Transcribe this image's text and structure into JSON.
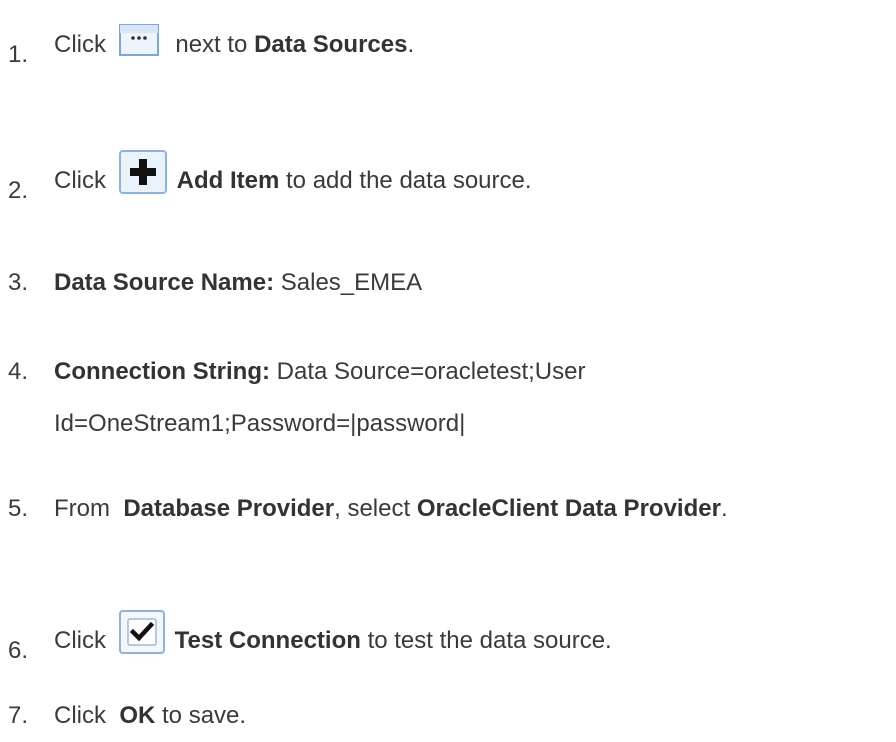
{
  "steps": [
    {
      "number": "1.",
      "text_before": "Click",
      "icon": "ellipsis-button-icon",
      "text_after": "next to",
      "bold": "Data Sources",
      "tail": "."
    },
    {
      "number": "2.",
      "text_before": "Click",
      "icon": "plus-add-icon",
      "bold": "Add Item",
      "tail": "to add the data source."
    },
    {
      "number": "3.",
      "bold": "Data Source Name:",
      "tail": "Sales_EMEA"
    },
    {
      "number": "4.",
      "bold": "Connection String:",
      "tail": "Data Source=oracletest;User",
      "continuation": "Id=OneStream1;Password=|password|"
    },
    {
      "number": "5.",
      "text_before": "From",
      "bold": "Database Provider",
      "text_after": ", select",
      "bold2": "OracleClient Data Provider",
      "tail": "."
    },
    {
      "number": "6.",
      "text_before": "Click",
      "icon": "checkmark-icon",
      "bold": "Test Connection",
      "tail": "to test the data source."
    },
    {
      "number": "7.",
      "text_before": "Click",
      "bold": "OK",
      "tail": "to save."
    }
  ],
  "colors": {
    "text": "#3a3a3a",
    "icon_border": "#7ea6d6",
    "icon_fill": "#e8f0fa"
  }
}
